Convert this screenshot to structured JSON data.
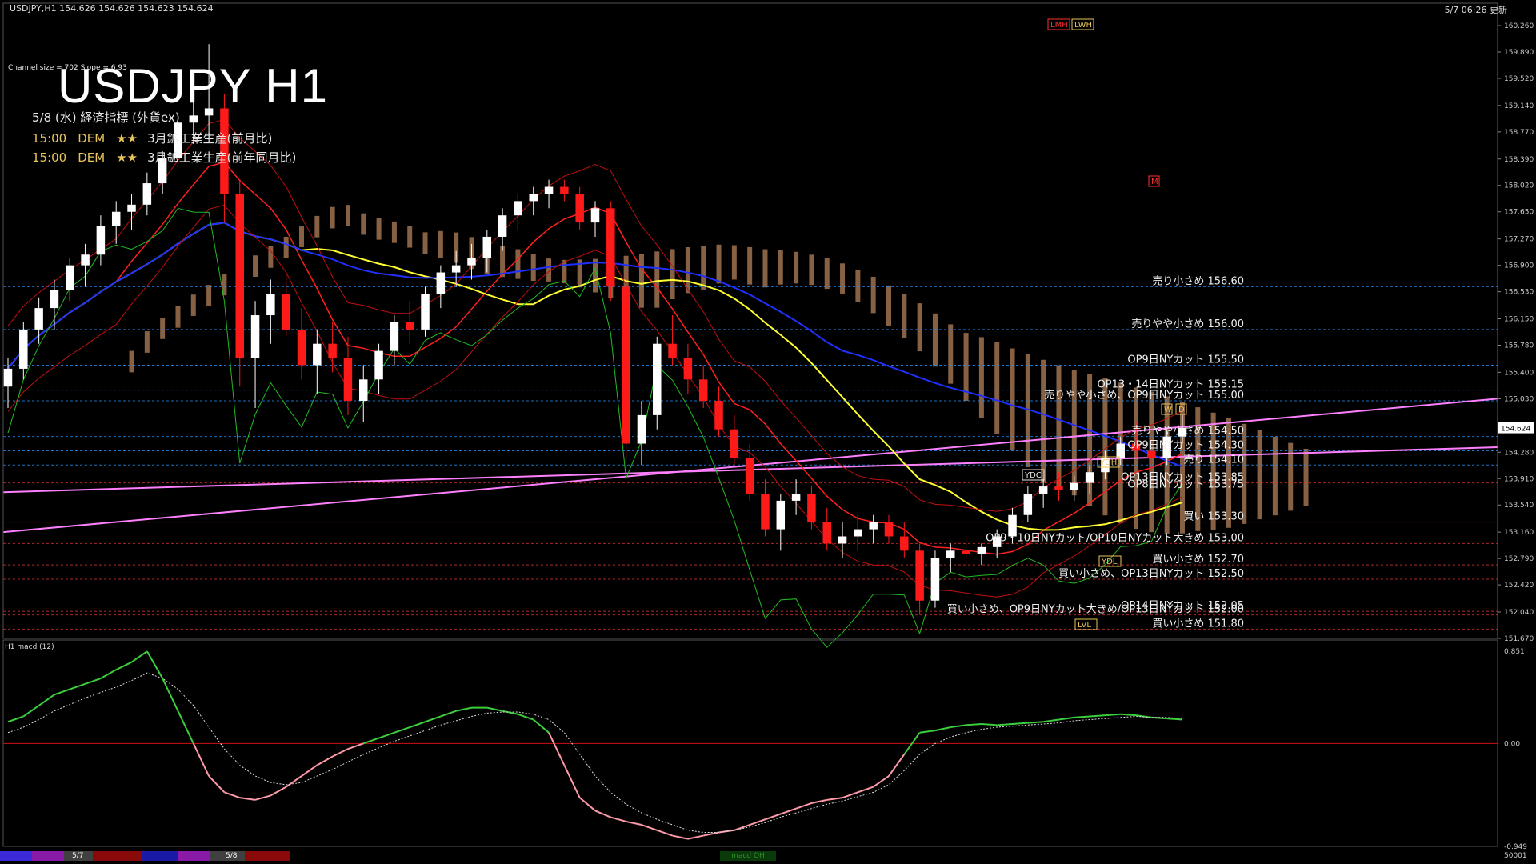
{
  "header": {
    "symbol_info": "USDJPY,H1  154.626 154.626 154.623 154.624",
    "timestamp": "5/7 06:26 更新"
  },
  "overlay": {
    "title": "USDJPY H1",
    "channel_info": "Channel size = 702 Slope = 6.93",
    "events_header": "5/8 (水) 経済指標 (外貨ex)",
    "events": [
      {
        "time": "15:00",
        "country": "DEM",
        "stars": "★★",
        "name": "3月鉱工業生産(前月比)"
      },
      {
        "time": "15:00",
        "country": "DEM",
        "stars": "★★",
        "name": "3月鉱工業生産(前年同月比)"
      }
    ]
  },
  "macd_label": "H1  macd (12)",
  "bottom_bar": {
    "dates": [
      "5/7",
      "5/8"
    ],
    "macd_tag": "macd OH",
    "right_num": "50001"
  },
  "colors": {
    "bull": "#ffffff",
    "bear": "#ff1a1a",
    "sma_fast": "#ffff33",
    "sma_slow": "#2030ff",
    "channel": "#ff80ff",
    "kumo": "#f5b07a",
    "macd": "#3ccf3c",
    "macd_neg": "#ff9aa9",
    "sell_line": "#1e90ff",
    "buy_line": "#e03030"
  },
  "chart_data": {
    "type": "candlestick",
    "title": "USDJPY H1",
    "timeframe": "H1",
    "ylim": [
      151.67,
      160.26
    ],
    "y_ticks": [
      160.26,
      159.89,
      159.52,
      159.14,
      158.77,
      158.39,
      158.02,
      157.65,
      157.27,
      156.9,
      156.53,
      156.15,
      155.78,
      155.4,
      155.03,
      154.28,
      153.91,
      153.54,
      153.16,
      152.79,
      152.42,
      152.04,
      151.67
    ],
    "current_price": 154.624,
    "x_labels": [
      "5/7",
      "5/8"
    ],
    "candles": [
      [
        155.2,
        155.6,
        154.9,
        155.45
      ],
      [
        155.45,
        156.1,
        155.3,
        156.0
      ],
      [
        156.0,
        156.45,
        155.8,
        156.3
      ],
      [
        156.3,
        156.7,
        156.0,
        156.55
      ],
      [
        156.55,
        157.0,
        156.4,
        156.9
      ],
      [
        156.9,
        157.2,
        156.6,
        157.05
      ],
      [
        157.05,
        157.6,
        156.9,
        157.45
      ],
      [
        157.45,
        157.8,
        157.2,
        157.65
      ],
      [
        157.65,
        157.9,
        157.4,
        157.75
      ],
      [
        157.75,
        158.2,
        157.6,
        158.05
      ],
      [
        158.05,
        158.5,
        157.9,
        158.4
      ],
      [
        158.4,
        159.0,
        158.2,
        158.9
      ],
      [
        158.9,
        159.2,
        158.6,
        159.0
      ],
      [
        159.0,
        160.0,
        158.7,
        159.1
      ],
      [
        159.1,
        159.3,
        157.5,
        157.9
      ],
      [
        157.9,
        158.1,
        155.2,
        155.6
      ],
      [
        155.6,
        156.4,
        154.9,
        156.2
      ],
      [
        156.2,
        156.7,
        155.8,
        156.5
      ],
      [
        156.5,
        156.8,
        155.9,
        156.0
      ],
      [
        156.0,
        156.3,
        155.3,
        155.5
      ],
      [
        155.5,
        156.0,
        155.1,
        155.8
      ],
      [
        155.8,
        156.1,
        155.4,
        155.6
      ],
      [
        155.6,
        155.9,
        154.8,
        155.0
      ],
      [
        155.0,
        155.5,
        154.7,
        155.3
      ],
      [
        155.3,
        155.8,
        155.1,
        155.7
      ],
      [
        155.7,
        156.2,
        155.5,
        156.1
      ],
      [
        156.1,
        156.4,
        155.8,
        156.0
      ],
      [
        156.0,
        156.6,
        155.9,
        156.5
      ],
      [
        156.5,
        156.9,
        156.3,
        156.8
      ],
      [
        156.8,
        157.1,
        156.6,
        156.9
      ],
      [
        156.9,
        157.2,
        156.7,
        157.0
      ],
      [
        157.0,
        157.4,
        156.8,
        157.3
      ],
      [
        157.3,
        157.7,
        157.1,
        157.6
      ],
      [
        157.6,
        157.9,
        157.4,
        157.8
      ],
      [
        157.8,
        158.0,
        157.6,
        157.9
      ],
      [
        157.9,
        158.1,
        157.7,
        158.0
      ],
      [
        158.0,
        158.1,
        157.8,
        157.9
      ],
      [
        157.9,
        158.0,
        157.4,
        157.5
      ],
      [
        157.5,
        157.8,
        157.3,
        157.7
      ],
      [
        157.7,
        157.8,
        156.4,
        156.6
      ],
      [
        156.6,
        156.8,
        154.2,
        154.4
      ],
      [
        154.4,
        155.0,
        154.1,
        154.8
      ],
      [
        154.8,
        155.9,
        154.6,
        155.8
      ],
      [
        155.8,
        156.2,
        155.5,
        155.6
      ],
      [
        155.6,
        155.8,
        155.1,
        155.3
      ],
      [
        155.3,
        155.5,
        154.9,
        155.0
      ],
      [
        155.0,
        155.2,
        154.5,
        154.6
      ],
      [
        154.6,
        154.8,
        154.1,
        154.2
      ],
      [
        154.2,
        154.4,
        153.6,
        153.7
      ],
      [
        153.7,
        153.9,
        153.1,
        153.2
      ],
      [
        153.2,
        153.7,
        152.9,
        153.6
      ],
      [
        153.6,
        153.9,
        153.4,
        153.7
      ],
      [
        153.7,
        153.8,
        153.2,
        153.3
      ],
      [
        153.3,
        153.5,
        152.9,
        153.0
      ],
      [
        153.0,
        153.3,
        152.8,
        153.1
      ],
      [
        153.1,
        153.4,
        152.9,
        153.2
      ],
      [
        153.2,
        153.4,
        153.0,
        153.3
      ],
      [
        153.3,
        153.4,
        153.0,
        153.1
      ],
      [
        153.1,
        153.3,
        152.8,
        152.9
      ],
      [
        152.9,
        153.0,
        152.0,
        152.2
      ],
      [
        152.2,
        152.9,
        152.1,
        152.8
      ],
      [
        152.8,
        153.0,
        152.6,
        152.9
      ],
      [
        152.9,
        153.1,
        152.7,
        152.85
      ],
      [
        152.85,
        153.0,
        152.7,
        152.95
      ],
      [
        152.95,
        153.2,
        152.8,
        153.1
      ],
      [
        153.1,
        153.5,
        153.0,
        153.4
      ],
      [
        153.4,
        153.8,
        153.3,
        153.7
      ],
      [
        153.7,
        153.9,
        153.5,
        153.8
      ],
      [
        153.8,
        154.0,
        153.6,
        153.75
      ],
      [
        153.75,
        153.95,
        153.6,
        153.85
      ],
      [
        153.85,
        154.1,
        153.7,
        154.0
      ],
      [
        154.0,
        154.3,
        153.9,
        154.2
      ],
      [
        154.2,
        154.5,
        154.1,
        154.4
      ],
      [
        154.4,
        154.7,
        154.2,
        154.3
      ],
      [
        154.3,
        154.5,
        154.0,
        154.2
      ],
      [
        154.2,
        154.6,
        154.1,
        154.5
      ],
      [
        154.5,
        154.8,
        154.4,
        154.62
      ]
    ],
    "price_levels": [
      {
        "label": "売り小さめ 156.60",
        "price": 156.6,
        "side": "sell"
      },
      {
        "label": "売りやや小さめ 156.00",
        "price": 156.0,
        "side": "sell"
      },
      {
        "label": "OP9日NYカット 155.50",
        "price": 155.5,
        "side": "sell"
      },
      {
        "label": "OP13・14日NYカット 155.15",
        "price": 155.15,
        "side": "sell"
      },
      {
        "label": "売りやや小さめ、OP9日NYカット 155.00",
        "price": 155.0,
        "side": "sell"
      },
      {
        "label": "売りやや小さめ 154.50",
        "price": 154.5,
        "side": "sell"
      },
      {
        "label": "OP9日NYカット 154.30",
        "price": 154.3,
        "side": "sell"
      },
      {
        "label": "売り 154.10",
        "price": 154.1,
        "side": "sell"
      },
      {
        "label": "OP13日NYカット 153.85",
        "price": 153.85,
        "side": "buy"
      },
      {
        "label": "OP8日NYカット 153.75",
        "price": 153.75,
        "side": "buy"
      },
      {
        "label": "買い 153.30",
        "price": 153.3,
        "side": "buy"
      },
      {
        "label": "OP9・10日NYカット/OP10日NYカット大きめ 153.00",
        "price": 153.0,
        "side": "buy"
      },
      {
        "label": "買い小さめ 152.70",
        "price": 152.7,
        "side": "buy"
      },
      {
        "label": "買い小さめ、OP13日NYカット 152.50",
        "price": 152.5,
        "side": "buy"
      },
      {
        "label": "OP14日NYカット 152.05",
        "price": 152.05,
        "side": "buy"
      },
      {
        "label": "買い小さめ、OP9日NYカット大きめ/OP13日NYカット 152.00",
        "price": 152.0,
        "side": "buy"
      },
      {
        "label": "買い小さめ 151.80",
        "price": 151.8,
        "side": "buy"
      }
    ],
    "tags": [
      "LMH",
      "LWH",
      "M",
      "W",
      "D",
      "YDH",
      "YDL",
      "YDC",
      "LVL"
    ],
    "macd": {
      "ylim": [
        -0.949,
        0.851
      ],
      "y_ticks": [
        0.851,
        0.0,
        -0.949
      ],
      "values": [
        0.2,
        0.25,
        0.35,
        0.45,
        0.5,
        0.55,
        0.6,
        0.68,
        0.75,
        0.85,
        0.6,
        0.3,
        0.0,
        -0.3,
        -0.45,
        -0.5,
        -0.52,
        -0.48,
        -0.4,
        -0.3,
        -0.2,
        -0.12,
        -0.05,
        0.0,
        0.05,
        0.1,
        0.15,
        0.2,
        0.25,
        0.3,
        0.33,
        0.33,
        0.3,
        0.27,
        0.22,
        0.1,
        -0.2,
        -0.5,
        -0.62,
        -0.68,
        -0.72,
        -0.75,
        -0.8,
        -0.85,
        -0.88,
        -0.85,
        -0.82,
        -0.8,
        -0.75,
        -0.7,
        -0.65,
        -0.6,
        -0.55,
        -0.52,
        -0.5,
        -0.45,
        -0.4,
        -0.3,
        -0.1,
        0.1,
        0.12,
        0.15,
        0.17,
        0.18,
        0.17,
        0.18,
        0.19,
        0.2,
        0.22,
        0.24,
        0.25,
        0.26,
        0.27,
        0.26,
        0.24,
        0.23,
        0.22
      ],
      "signal": [
        0.1,
        0.15,
        0.22,
        0.3,
        0.36,
        0.42,
        0.47,
        0.52,
        0.58,
        0.65,
        0.6,
        0.5,
        0.35,
        0.15,
        -0.05,
        -0.2,
        -0.3,
        -0.36,
        -0.38,
        -0.36,
        -0.3,
        -0.24,
        -0.17,
        -0.1,
        -0.04,
        0.02,
        0.07,
        0.12,
        0.17,
        0.21,
        0.25,
        0.28,
        0.29,
        0.29,
        0.27,
        0.22,
        0.1,
        -0.1,
        -0.3,
        -0.45,
        -0.56,
        -0.64,
        -0.7,
        -0.75,
        -0.8,
        -0.82,
        -0.82,
        -0.8,
        -0.77,
        -0.73,
        -0.68,
        -0.64,
        -0.6,
        -0.56,
        -0.53,
        -0.49,
        -0.45,
        -0.38,
        -0.25,
        -0.1,
        0.0,
        0.06,
        0.1,
        0.13,
        0.15,
        0.16,
        0.17,
        0.18,
        0.19,
        0.21,
        0.22,
        0.23,
        0.24,
        0.25,
        0.24,
        0.24,
        0.23
      ]
    }
  }
}
